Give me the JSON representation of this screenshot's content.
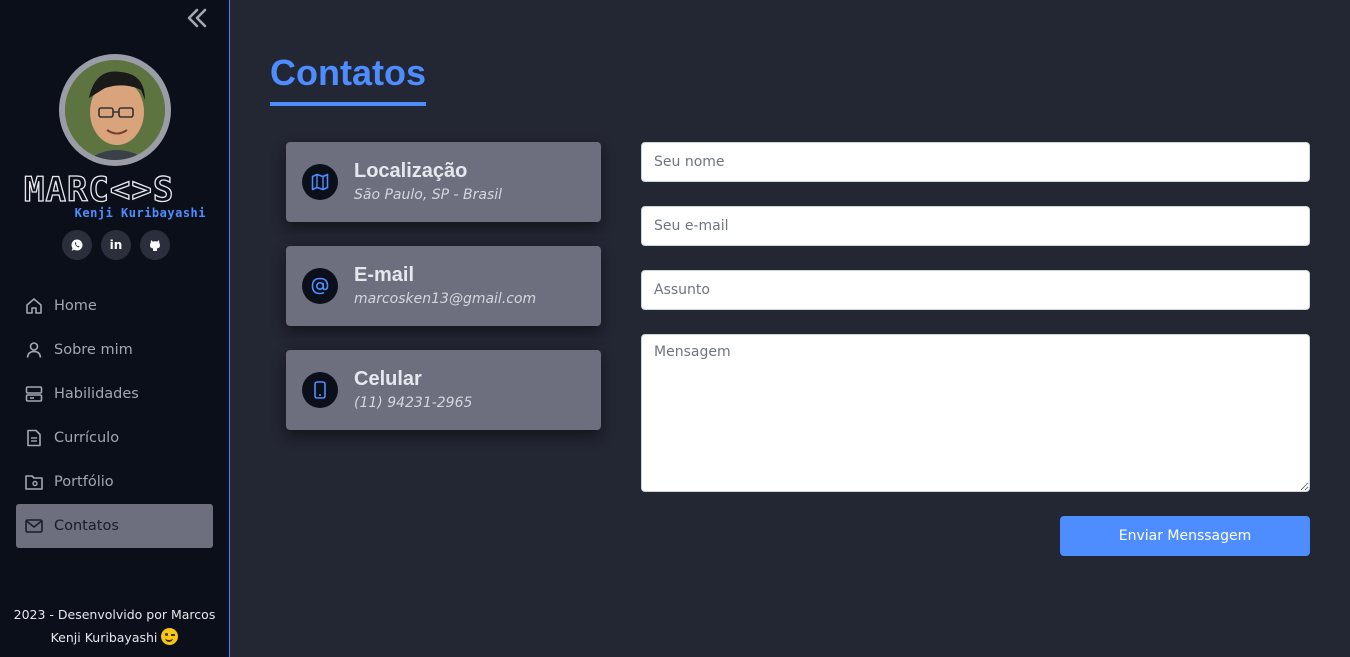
{
  "sidebar": {
    "logo": {
      "main": "MARC<>S",
      "sub": "Kenji Kuribayashi"
    },
    "socials": [
      {
        "icon": "whatsapp-icon"
      },
      {
        "icon": "linkedin-icon",
        "label": "in"
      },
      {
        "icon": "github-icon"
      }
    ],
    "nav": [
      {
        "label": "Home",
        "icon": "home-icon"
      },
      {
        "label": "Sobre mim",
        "icon": "user-icon"
      },
      {
        "label": "Habilidades",
        "icon": "server-icon"
      },
      {
        "label": "Currículo",
        "icon": "document-icon"
      },
      {
        "label": "Portfólio",
        "icon": "folder-icon"
      },
      {
        "label": "Contatos",
        "icon": "mail-icon",
        "active": true
      }
    ],
    "footer": {
      "line1": "2023 - Desenvolvido por Marcos",
      "line2": "Kenji Kuribayashi"
    }
  },
  "main": {
    "title": "Contatos",
    "cards": [
      {
        "title": "Localização",
        "value": "São Paulo, SP - Brasil",
        "icon": "map-icon"
      },
      {
        "title": "E-mail",
        "value": "marcosken13@gmail.com",
        "icon": "at-icon"
      },
      {
        "title": "Celular",
        "value": "(11) 94231-2965",
        "icon": "phone-icon"
      }
    ],
    "form": {
      "name_placeholder": "Seu nome",
      "email_placeholder": "Seu e-mail",
      "subject_placeholder": "Assunto",
      "message_placeholder": "Mensagem",
      "submit_label": "Enviar Menssagem"
    }
  },
  "colors": {
    "accent": "#4e8dff",
    "background": "#232633",
    "sidebar": "#0b0f1a",
    "card": "#6d6f7e"
  }
}
